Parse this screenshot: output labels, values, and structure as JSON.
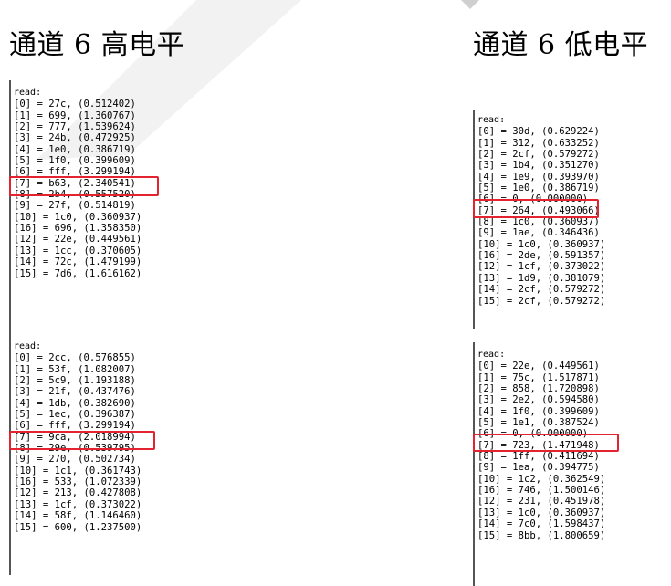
{
  "headings": {
    "left": "通道 6 高电平",
    "right": "通道 6 低电平"
  },
  "panels": {
    "high_1": {
      "label": "read:",
      "lines": [
        "[0] = 27c, (0.512402)",
        "[1] = 699, (1.360767)",
        "[2] = 777, (1.539624)",
        "[3] = 24b, (0.472925)",
        "[4] = 1e0, (0.386719)",
        "[5] = 1f0, (0.399609)",
        "[6] = fff, (3.299194)",
        "[7] = b63, (2.340541)",
        "[8] = 2b4, (0.557520)",
        "[9] = 27f, (0.514819)",
        "[10] = 1c0, (0.360937)",
        "[16] = 696, (1.358350)",
        "[12] = 22e, (0.449561)",
        "[13] = 1cc, (0.370605)",
        "[14] = 72c, (1.479199)",
        "[15] = 7d6, (1.616162)"
      ]
    },
    "high_2": {
      "label": "read:",
      "lines": [
        "[0] = 2cc, (0.576855)",
        "[1] = 53f, (1.082007)",
        "[2] = 5c9, (1.193188)",
        "[3] = 21f, (0.437476)",
        "[4] = 1db, (0.382690)",
        "[5] = 1ec, (0.396387)",
        "[6] = fff, (3.299194)",
        "[7] = 9ca, (2.018994)",
        "[8] = 29e, (0.539795)",
        "[9] = 270, (0.502734)",
        "[10] = 1c1, (0.361743)",
        "[16] = 533, (1.072339)",
        "[12] = 213, (0.427808)",
        "[13] = 1cf, (0.373022)",
        "[14] = 58f, (1.146460)",
        "[15] = 600, (1.237500)"
      ]
    },
    "low_1": {
      "label": "read:",
      "lines": [
        "[0] = 30d, (0.629224)",
        "[1] = 312, (0.633252)",
        "[2] = 2cf, (0.579272)",
        "[3] = 1b4, (0.351270)",
        "[4] = 1e9, (0.393970)",
        "[5] = 1e0, (0.386719)",
        "[6] = 0, (0.000000)",
        "[7] = 264, (0.493066)",
        "[8] = 1c0, (0.360937)",
        "[9] = 1ae, (0.346436)",
        "[10] = 1c0, (0.360937)",
        "[16] = 2de, (0.591357)",
        "[12] = 1cf, (0.373022)",
        "[13] = 1d9, (0.381079)",
        "[14] = 2cf, (0.579272)",
        "[15] = 2cf, (0.579272)"
      ]
    },
    "low_2": {
      "label": "read:",
      "lines": [
        "[0] = 22e, (0.449561)",
        "[1] = 75c, (1.517871)",
        "[2] = 858, (1.720898)",
        "[3] = 2e2, (0.594580)",
        "[4] = 1f0, (0.399609)",
        "[5] = 1e1, (0.387524)",
        "[6] = 0, (0.000000)",
        "[7] = 723, (1.471948)",
        "[8] = 1ff, (0.411694)",
        "[9] = 1ea, (0.394775)",
        "[10] = 1c2, (0.362549)",
        "[16] = 746, (1.500146)",
        "[12] = 231, (0.451978)",
        "[13] = 1c0, (0.360937)",
        "[14] = 7c0, (1.598437)",
        "[15] = 8bb, (1.800659)"
      ]
    }
  },
  "colors": {
    "highlight": "#e3232f",
    "background_stroke": "#eeeeee"
  }
}
